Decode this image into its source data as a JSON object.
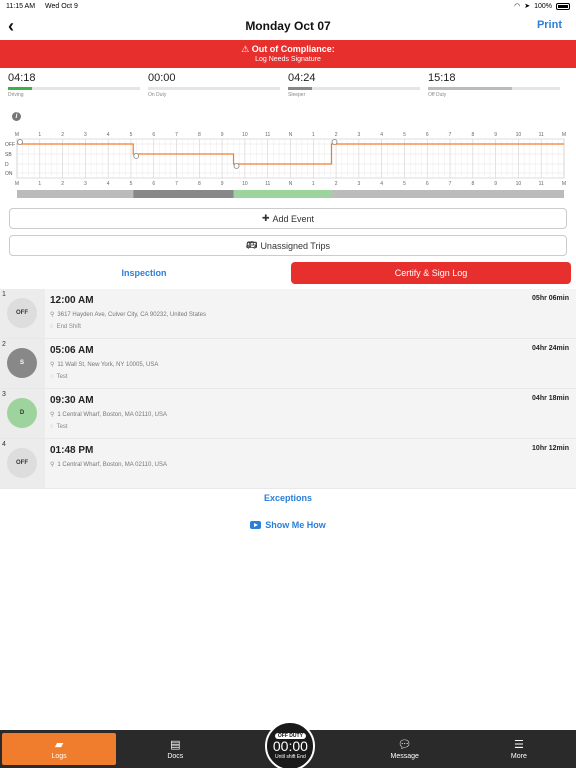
{
  "status_bar": {
    "time": "11:15 AM",
    "date": "Wed Oct 9",
    "battery": "100%"
  },
  "nav": {
    "title": "Monday Oct 07",
    "print_label": "Print"
  },
  "alert": {
    "title": "Out of Compliance:",
    "subtitle": "Log Needs Signature"
  },
  "totals": [
    {
      "time": "04:18",
      "label": "Driving",
      "fraction": 0.18,
      "color": "#3cb04a"
    },
    {
      "time": "00:00",
      "label": "On Duty",
      "fraction": 0.0,
      "color": "#2b7fd9"
    },
    {
      "time": "04:24",
      "label": "Sleeper",
      "fraction": 0.18,
      "color": "#888888"
    },
    {
      "time": "15:18",
      "label": "Off Duty",
      "fraction": 0.64,
      "color": "#bbbbbb"
    }
  ],
  "graph": {
    "hour_labels": [
      "M",
      "1",
      "2",
      "3",
      "4",
      "5",
      "6",
      "7",
      "8",
      "9",
      "10",
      "11",
      "N",
      "1",
      "2",
      "3",
      "4",
      "5",
      "6",
      "7",
      "8",
      "9",
      "10",
      "11",
      "M"
    ],
    "row_labels": [
      "OFF",
      "SB",
      "D",
      "ON"
    ],
    "segments": [
      {
        "status": 0,
        "start": 0.0,
        "end": 5.1
      },
      {
        "status": 1,
        "start": 5.1,
        "end": 9.5
      },
      {
        "status": 2,
        "start": 9.5,
        "end": 13.8
      },
      {
        "status": 0,
        "start": 13.8,
        "end": 24.0
      }
    ],
    "colors": {
      "line": "#f07d2e",
      "off": "#bbbbbb",
      "sleeper": "#888888",
      "driving": "#9dd49d"
    }
  },
  "buttons": {
    "add_event": "Add Event",
    "unassigned_trips": "Unassigned Trips"
  },
  "tabs": {
    "inspection": "Inspection",
    "certify": "Certify & Sign Log"
  },
  "events": [
    {
      "num": "1",
      "status": "OFF",
      "circle_color": "#dddddd",
      "time": "12:00 AM",
      "duration": "05hr 06min",
      "address": "3617 Hayden Ave, Culver City, CA  90232, United States",
      "note": "End Shift"
    },
    {
      "num": "2",
      "status": "S",
      "circle_color": "#888888",
      "time": "05:06 AM",
      "duration": "04hr 24min",
      "address": "11 Wall St, New York, NY 10005, USA",
      "note": "Test"
    },
    {
      "num": "3",
      "status": "D",
      "circle_color": "#9dd49d",
      "time": "09:30 AM",
      "duration": "04hr 18min",
      "address": "1 Central Wharf, Boston, MA 02110, USA",
      "note": "Test"
    },
    {
      "num": "4",
      "status": "OFF",
      "circle_color": "#dddddd",
      "time": "01:48 PM",
      "duration": "10hr 12min",
      "address": "1 Central Wharf, Boston, MA 02110, USA",
      "note": ""
    }
  ],
  "links": {
    "exceptions": "Exceptions",
    "show_me_how": "Show Me How"
  },
  "bottom_nav": {
    "logs": "Logs",
    "docs": "Docs",
    "duty_tag": "OFF DUTY",
    "clock": "00:00",
    "clock_sub": "Until shift End",
    "message": "Message",
    "more": "More"
  }
}
